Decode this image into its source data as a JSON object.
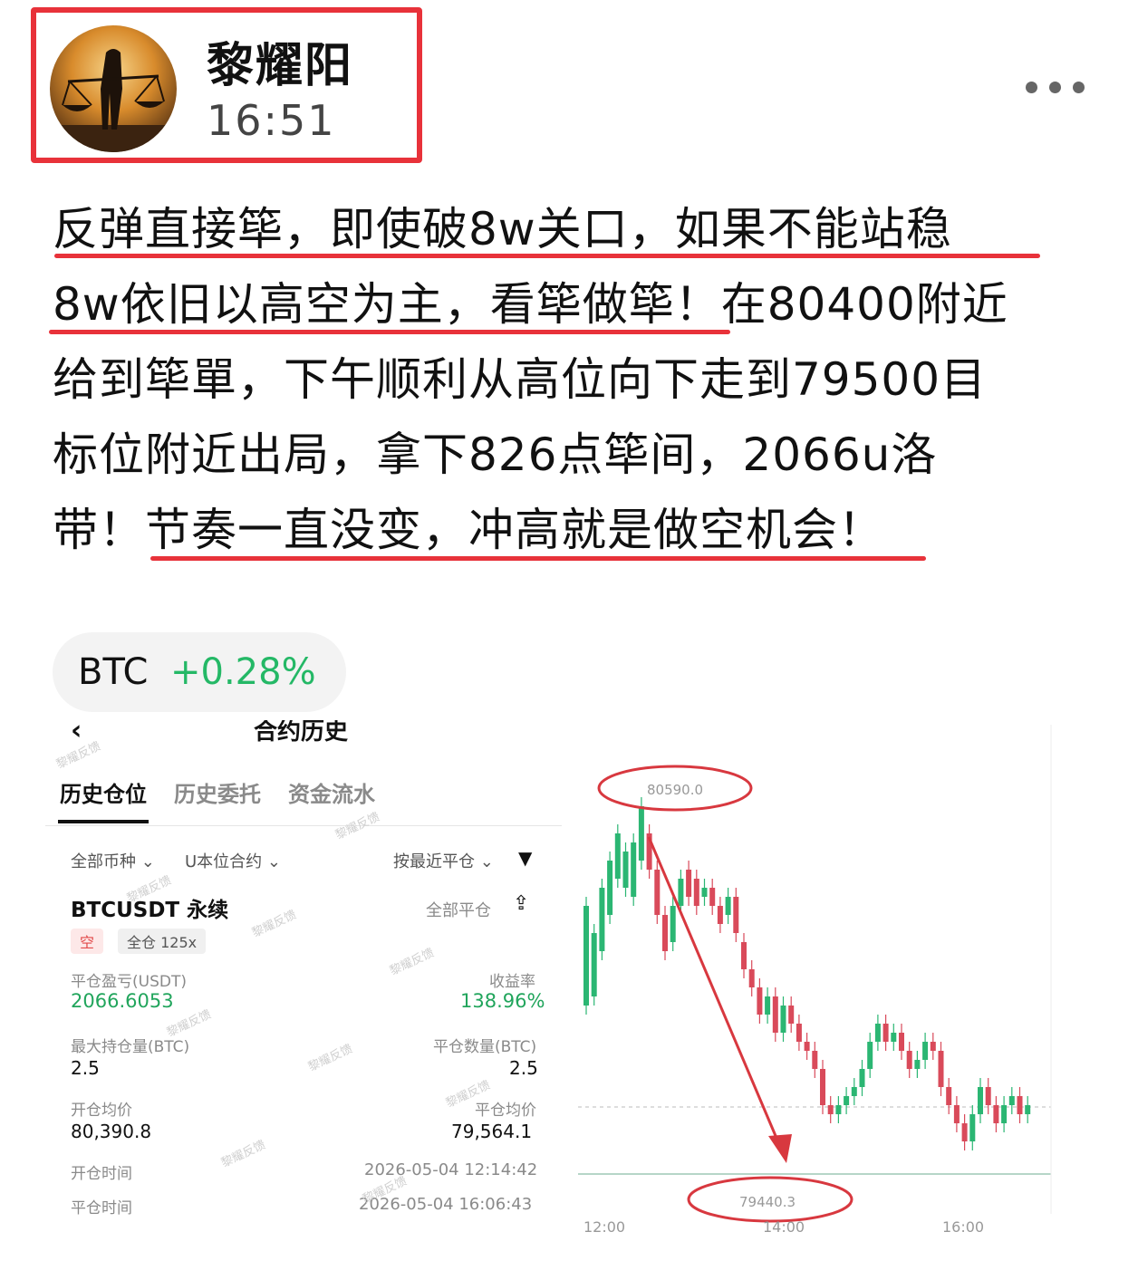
{
  "header": {
    "name": "黎耀阳",
    "time": "16:51"
  },
  "post": {
    "lines": [
      "反弹直接筚，即使破8w关口，如果不能站稳",
      "8w依旧以高空为主，看筚做筚！在80400附近",
      "给到筚單，下午顺利从高位向下走到79500目",
      "标位附近出局，拿下826点筚间，2066u洛",
      "带！节奏一直没变，冲高就是做空机会！"
    ]
  },
  "ticker": {
    "symbol": "BTC",
    "change": "+0.28%"
  },
  "history": {
    "title": "合约历史",
    "tabs": [
      "历史仓位",
      "历史委托",
      "资金流水"
    ],
    "filter_coin": "全部币种",
    "filter_contract": "U本位合约",
    "sort": "按最近平仓",
    "pair": "BTCUSDT 永续",
    "close_all": "全部平仓",
    "side": "空",
    "margin": "全仓 125x",
    "pnl_label": "平仓盈亏(USDT)",
    "pnl_value": "2066.6053",
    "roi_label": "收益率",
    "roi_value": "138.96%",
    "max_pos_label": "最大持仓量(BTC)",
    "max_pos_value": "2.5",
    "close_qty_label": "平仓数量(BTC)",
    "close_qty_value": "2.5",
    "open_avg_label": "开仓均价",
    "open_avg_value": "80,390.8",
    "close_avg_label": "平仓均价",
    "close_avg_value": "79,564.1",
    "open_time_label": "开仓时间",
    "open_time_value": "2026-05-04 12:14:42",
    "close_time_label": "平仓时间",
    "close_time_value": "2026-05-04 16:06:43",
    "watermark": "黎耀反馈"
  },
  "chart_data": {
    "type": "candlestick",
    "high_label": "80590.0",
    "low_label": "79440.3",
    "x_ticks": [
      "12:00",
      "14:00",
      "16:00"
    ],
    "up_color": "#2bb673",
    "down_color": "#d94a5a"
  }
}
